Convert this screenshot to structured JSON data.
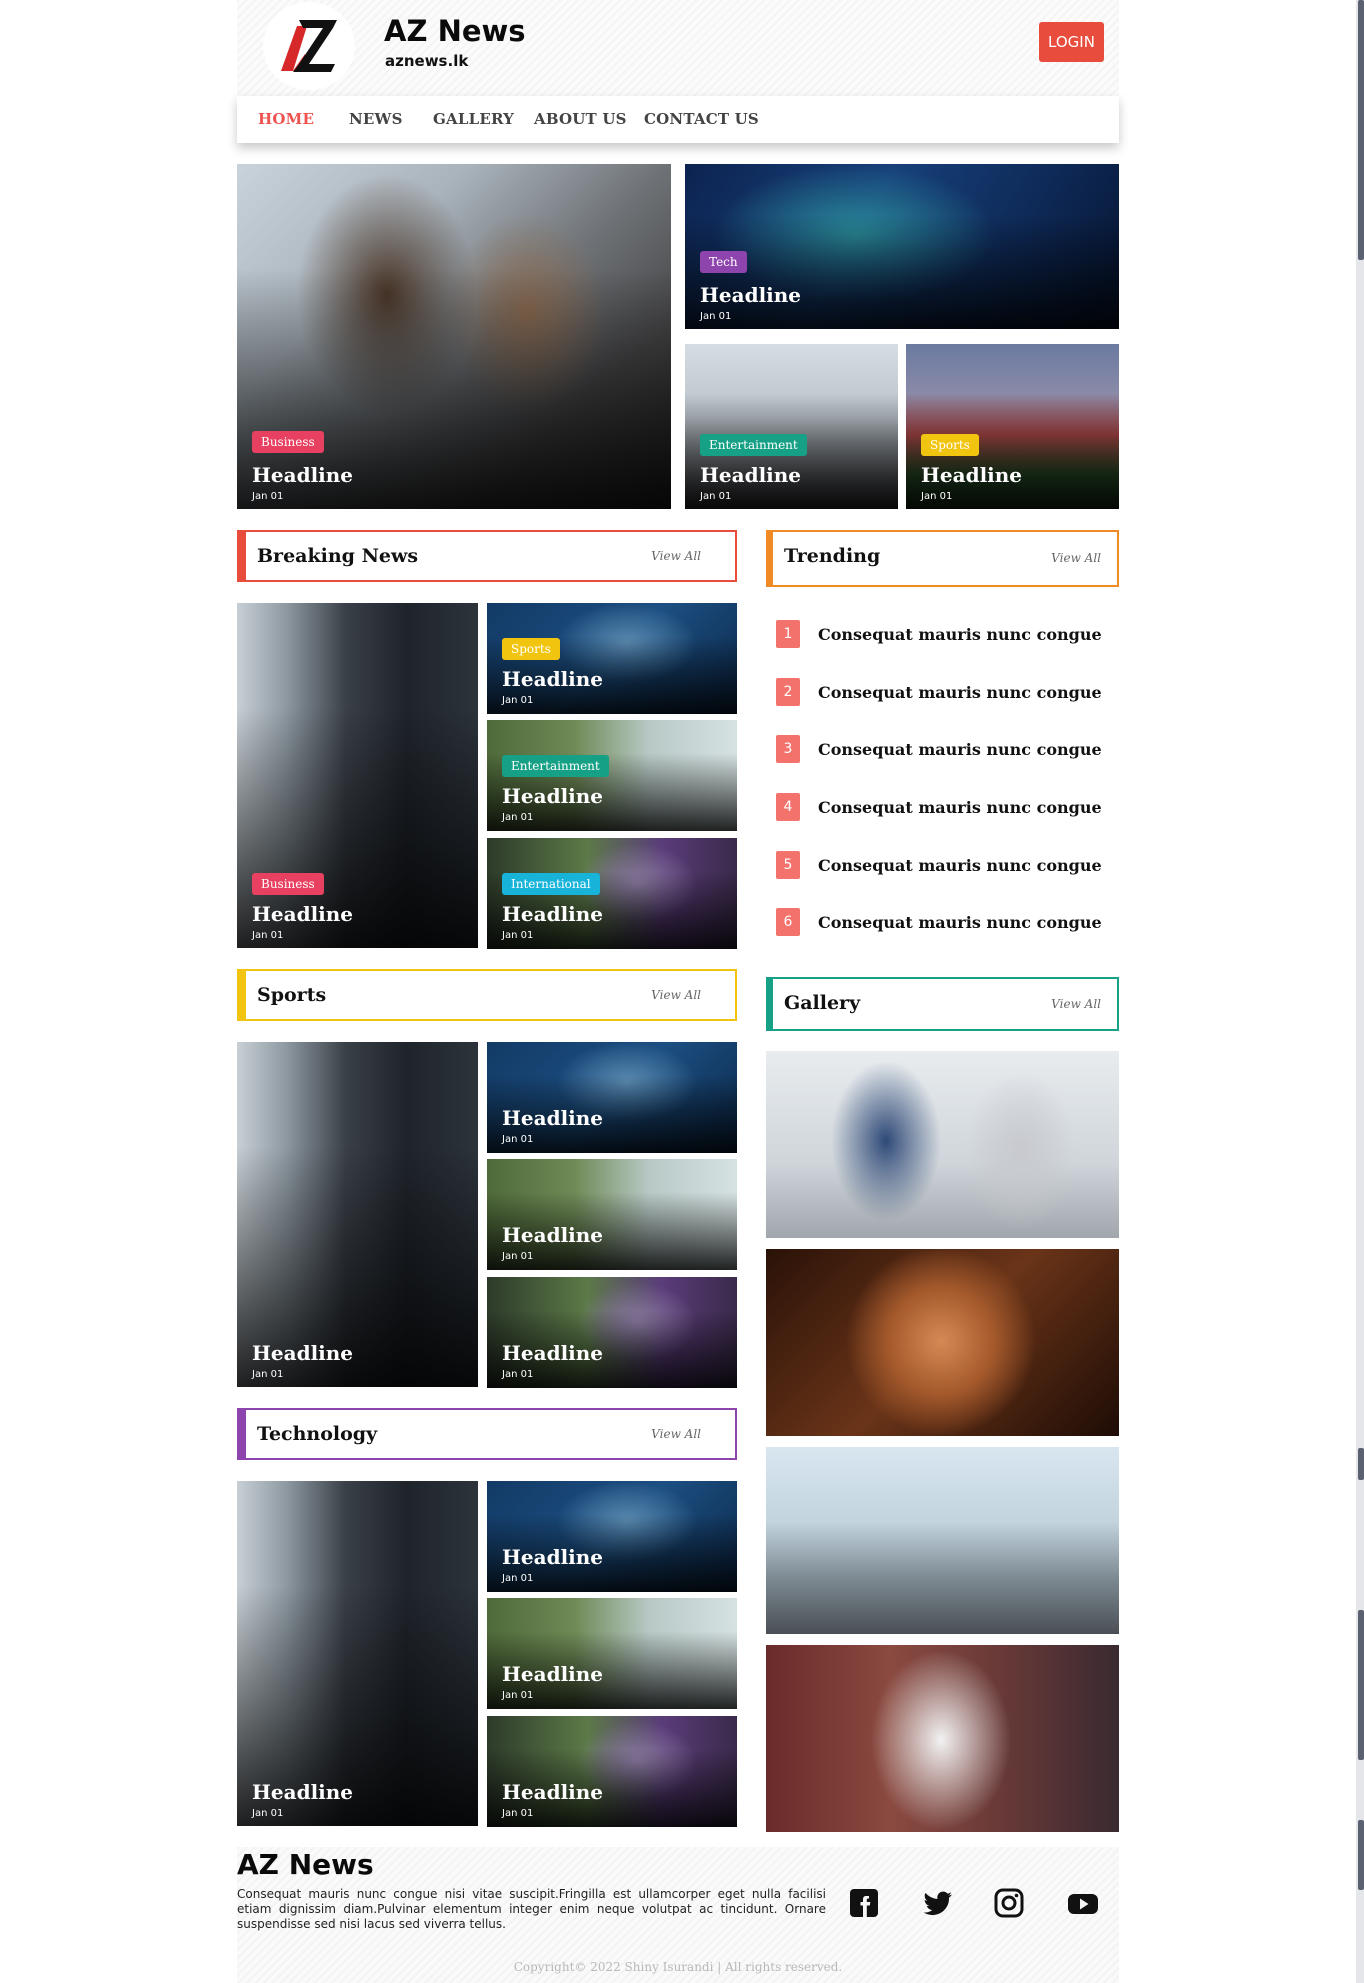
{
  "header": {
    "brand": "AZ News",
    "domain": "aznews.lk",
    "login_label": "LOGIN"
  },
  "nav": [
    "HOME",
    "NEWS",
    "GALLERY",
    "ABOUT US",
    "CONTACT US"
  ],
  "hero": [
    {
      "tag": "Business",
      "headline": "Headline",
      "date": "Jan 01"
    },
    {
      "tag": "Tech",
      "headline": "Headline",
      "date": "Jan 01"
    },
    {
      "tag": "Entertainment",
      "headline": "Headline",
      "date": "Jan 01"
    },
    {
      "tag": "Sports",
      "headline": "Headline",
      "date": "Jan 01"
    }
  ],
  "sections": {
    "breaking": {
      "title": "Breaking News",
      "view_all": "View All"
    },
    "trending": {
      "title": "Trending",
      "view_all": "View All"
    },
    "sports": {
      "title": "Sports",
      "view_all": "View All"
    },
    "gallery": {
      "title": "Gallery",
      "view_all": "View All"
    },
    "technology": {
      "title": "Technology",
      "view_all": "View All"
    }
  },
  "breaking_cards": [
    {
      "tag": "Business",
      "headline": "Headline",
      "date": "Jan 01"
    },
    {
      "tag": "Sports",
      "headline": "Headline",
      "date": "Jan 01"
    },
    {
      "tag": "Entertainment",
      "headline": "Headline",
      "date": "Jan 01"
    },
    {
      "tag": "International",
      "headline": "Headline",
      "date": "Jan 01"
    }
  ],
  "sports_cards": [
    {
      "headline": "Headline",
      "date": "Jan 01"
    },
    {
      "headline": "Headline",
      "date": "Jan 01"
    },
    {
      "headline": "Headline",
      "date": "Jan 01"
    },
    {
      "headline": "Headline",
      "date": "Jan 01"
    }
  ],
  "tech_cards": [
    {
      "headline": "Headline",
      "date": "Jan 01"
    },
    {
      "headline": "Headline",
      "date": "Jan 01"
    },
    {
      "headline": "Headline",
      "date": "Jan 01"
    },
    {
      "headline": "Headline",
      "date": "Jan 01"
    }
  ],
  "trending": [
    {
      "num": "1",
      "text": "Consequat mauris nunc congue"
    },
    {
      "num": "2",
      "text": "Consequat mauris nunc congue"
    },
    {
      "num": "3",
      "text": "Consequat mauris nunc congue"
    },
    {
      "num": "4",
      "text": "Consequat mauris nunc congue"
    },
    {
      "num": "5",
      "text": "Consequat mauris nunc congue"
    },
    {
      "num": "6",
      "text": "Consequat mauris nunc congue"
    }
  ],
  "footer": {
    "brand": "AZ News",
    "description": "Consequat mauris nunc congue nisi vitae suscipit.Fringilla est ullamcorper eget nulla facilisi etiam dignissim diam.Pulvinar elementum integer enim neque volutpat ac tincidunt. Ornare suspendisse sed nisi lacus sed viverra tellus.",
    "copyright": "Copyright© 2022 Shiny Isurandi | All rights reserved.",
    "social_icons": [
      "facebook-icon",
      "twitter-icon",
      "instagram-icon",
      "youtube-icon"
    ]
  },
  "colors": {
    "accent": "#ef5350",
    "login": "#e74c3c",
    "business": "#e84060",
    "tech": "#8e44ad",
    "entertainment": "#16a085",
    "sports": "#f1c40f",
    "international": "#17b3d8",
    "breaking_border": "#e74c3c",
    "trending_border": "#f08a24",
    "sports_border": "#f1c40f",
    "gallery_border": "#16a085",
    "technology_border": "#8e44ad"
  }
}
